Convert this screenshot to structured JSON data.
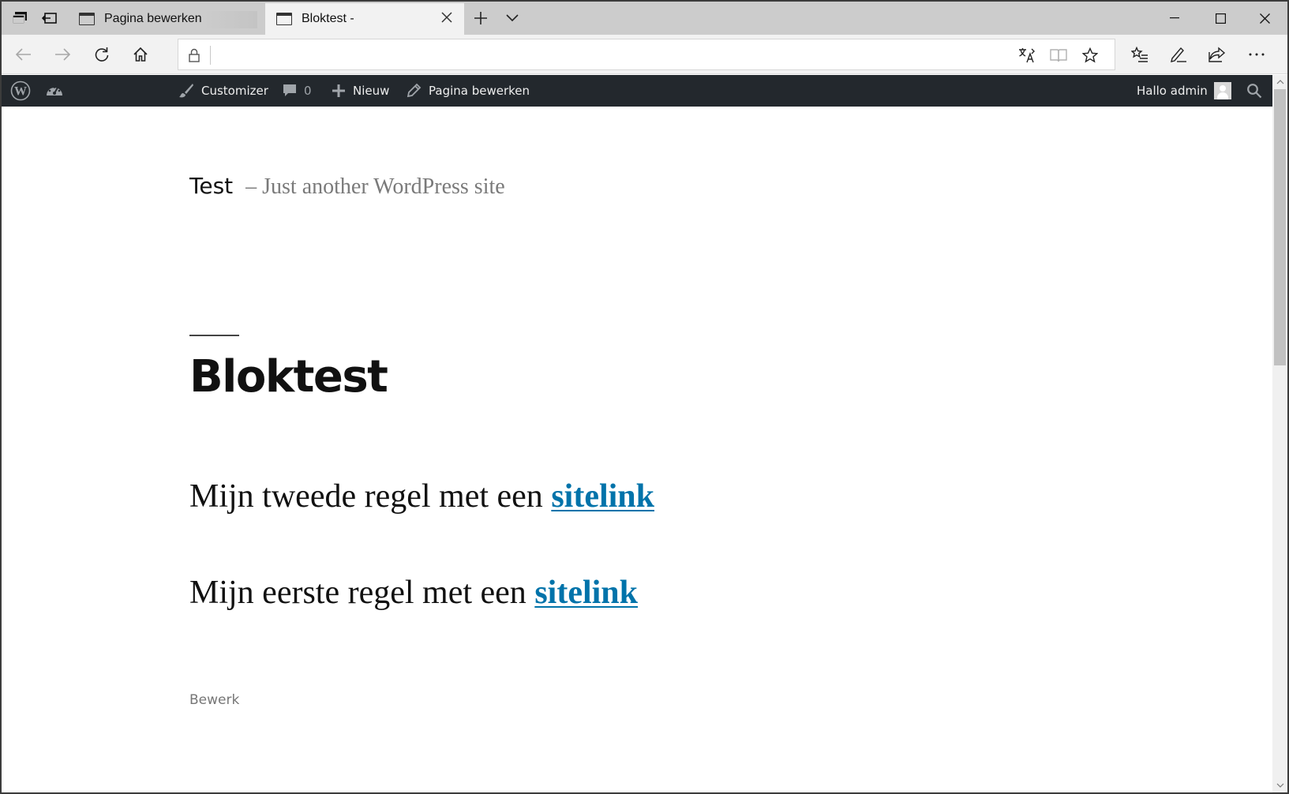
{
  "browser": {
    "tabs": [
      {
        "title": "Pagina bewerken",
        "active": false
      },
      {
        "title": "Bloktest -",
        "active": true
      }
    ],
    "address": {
      "value": ""
    }
  },
  "adminbar": {
    "customizer": "Customizer",
    "comments_count": "0",
    "new": "Nieuw",
    "edit_page": "Pagina bewerken",
    "greeting": "Hallo admin"
  },
  "site": {
    "title": "Test",
    "description": "– Just another WordPress site"
  },
  "page": {
    "title": "Bloktest",
    "paragraphs": [
      {
        "text": "Mijn tweede regel met een ",
        "link": "sitelink"
      },
      {
        "text": "Mijn eerste regel met een ",
        "link": "sitelink"
      }
    ],
    "edit_link": "Bewerk"
  },
  "colors": {
    "adminbar_bg": "#23282d",
    "link": "#0073aa",
    "tabbar_bg": "#cccccc"
  }
}
